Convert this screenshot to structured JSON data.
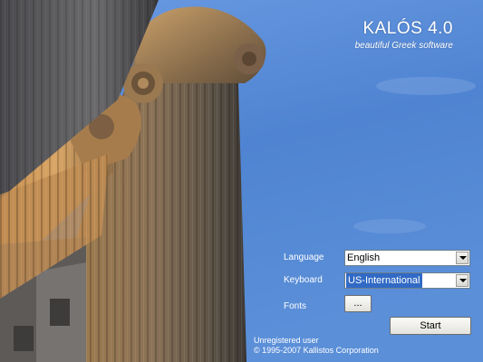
{
  "app": {
    "title": "KALÓS 4.0",
    "subtitle": "beautiful Greek software"
  },
  "form": {
    "language_label": "Language",
    "language_value": "English",
    "keyboard_label": "Keyboard",
    "keyboard_value": "US-International",
    "fonts_label": "Fonts",
    "fonts_button": "...",
    "start_button": "Start"
  },
  "footer": {
    "user": "Unregistered user",
    "copyright": "© 1995-2007  Kallistos  Corporation"
  },
  "icons": [
    "chevron-down-icon",
    "chevron-down-icon"
  ],
  "colors": {
    "sky": "#4f84d2",
    "stone": "#b08a5c",
    "selection": "#316ac5"
  }
}
